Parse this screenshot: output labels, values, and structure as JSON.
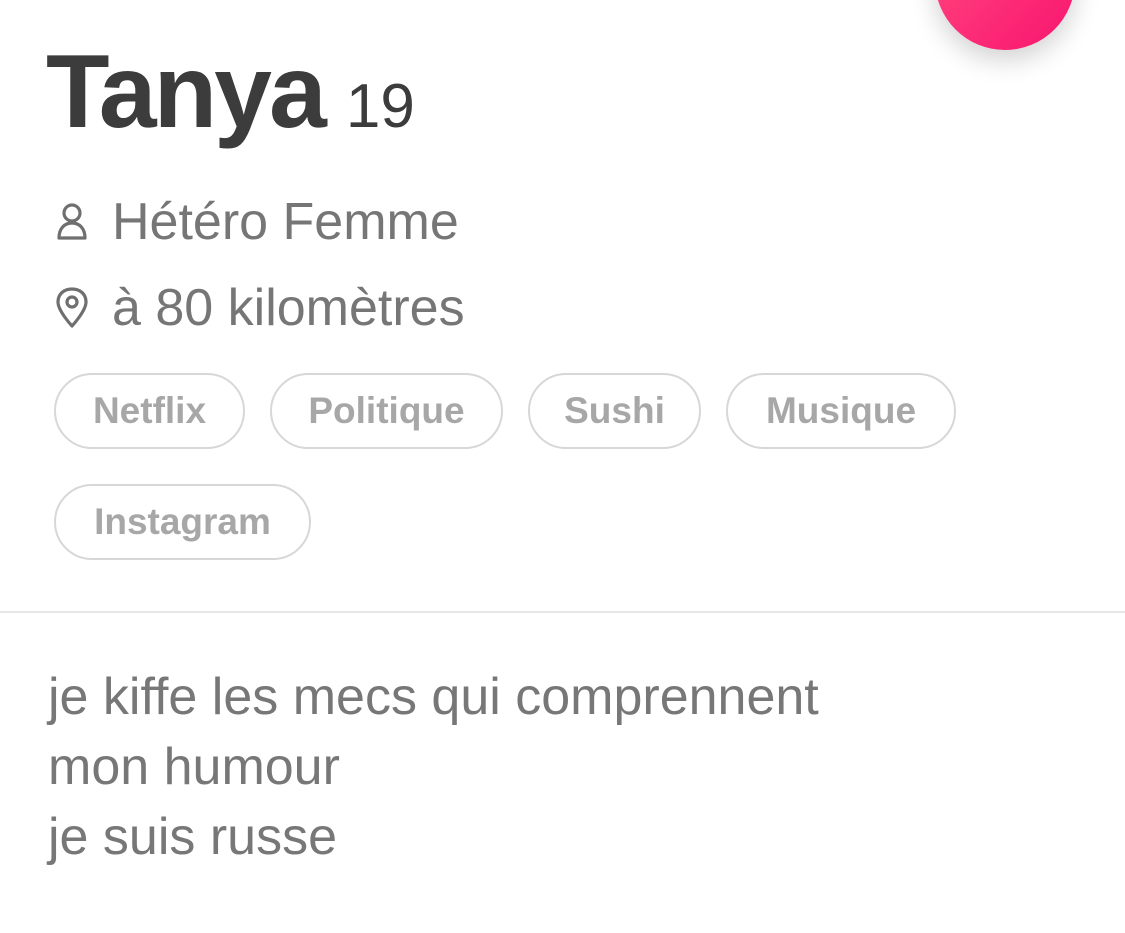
{
  "header": {
    "name": "Tanya",
    "age": "19"
  },
  "info": {
    "orientation": "Hétéro Femme",
    "distance": "à 80 kilomètres"
  },
  "interests": [
    "Netflix",
    "Politique",
    "Sushi",
    "Musique",
    "Instagram"
  ],
  "bio": {
    "lines": [
      "je kiffe les mecs qui comprennent",
      "mon humour",
      "je suis russe"
    ]
  },
  "icons": {
    "orientation": "person-icon",
    "distance": "location-pin-icon",
    "like_button": "heart-icon"
  },
  "colors": {
    "accent": "#fd2d78",
    "title_text": "#3c3c3c",
    "secondary_text": "#767676",
    "chip_border": "#d7d7d7",
    "chip_text": "#a7a7a7"
  }
}
